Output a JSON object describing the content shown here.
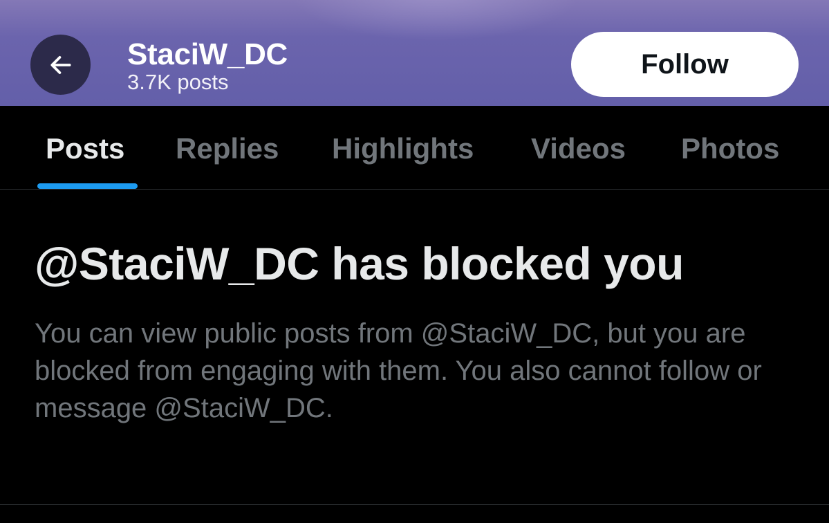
{
  "header": {
    "profile_name": "StaciW_DC",
    "post_count": "3.7K posts",
    "follow_label": "Follow",
    "back_icon": "arrow-left-icon"
  },
  "tabs": [
    {
      "label": "Posts",
      "active": true
    },
    {
      "label": "Replies",
      "active": false
    },
    {
      "label": "Highlights",
      "active": false
    },
    {
      "label": "Videos",
      "active": false
    },
    {
      "label": "Photos",
      "active": false
    }
  ],
  "notice": {
    "title": "@StaciW_DC has blocked you",
    "body": "You can view public posts from @StaciW_DC, but you are blocked from engaging with them. You also cannot follow or message @StaciW_DC."
  },
  "colors": {
    "header_bg": "#635fa9",
    "accent_blue": "#1d9bf0",
    "background": "#000000",
    "primary_text": "#e7e9ea",
    "secondary_text": "#71767b"
  }
}
